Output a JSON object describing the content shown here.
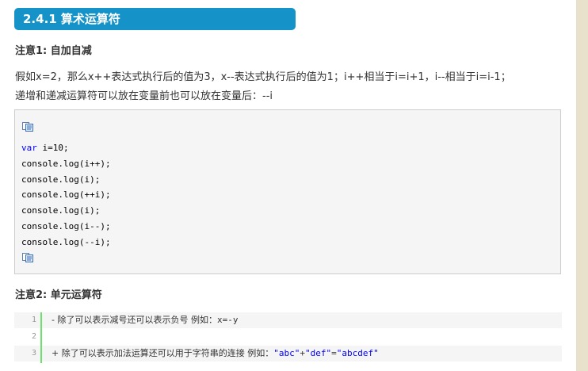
{
  "heading": "2.4.1 算术运算符",
  "note1": "注意1: 自加自减",
  "para1_line1": "假如x=2，那么x++表达式执行后的值为3，x--表达式执行后的值为1；i++相当于i=i+1，i--相当于i=i-1；",
  "para1_line2": "递增和递减运算符可以放在变量前也可以放在变量后：--i",
  "code": {
    "keyword": "var",
    "line1_rest": " i=10;",
    "lines": [
      "console.log(i++);",
      "console.log(i);",
      "console.log(++i);",
      "console.log(i);",
      "console.log(i--);",
      "console.log(--i);"
    ]
  },
  "note2": "注意2: 单元运算符",
  "list": {
    "numbers": [
      "1",
      "2",
      "3"
    ],
    "line1_text": "- 除了可以表示减号还可以表示负号   例如：",
    "line1_code": "x=-y",
    "line3_text": "+ 除了可以表示加法运算还可以用于字符串的连接   例如：",
    "line3_s1": "\"abc\"",
    "line3_plus": "+",
    "line3_s2": "\"def\"",
    "line3_eq": "=",
    "line3_s3": "\"abcdef\""
  },
  "colors": {
    "heading_bg": "#1593c8",
    "gutter_bar": "#6ce26c",
    "keyword": "#0000ff"
  },
  "icons": [
    "copy-code-icon",
    "copy-code-icon"
  ]
}
